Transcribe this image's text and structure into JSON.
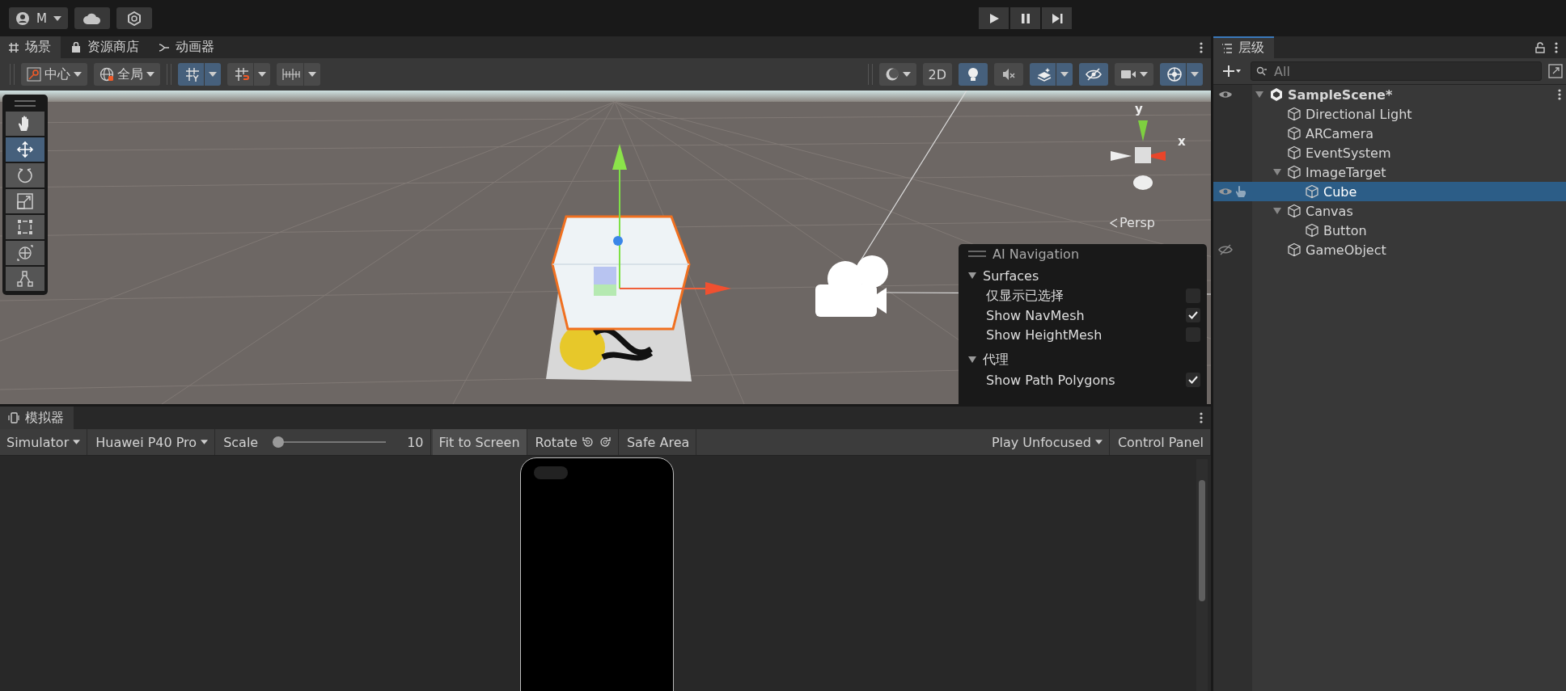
{
  "top_bar": {
    "account": {
      "label": "M"
    },
    "play_controls": [
      {
        "kind": "play",
        "selected": false
      },
      {
        "kind": "pause",
        "selected": false
      },
      {
        "kind": "step",
        "selected": false
      }
    ]
  },
  "scene_tabs": [
    {
      "label": "场景",
      "kind": "grid",
      "selected": true
    },
    {
      "label": "资源商店",
      "kind": "bag",
      "selected": false
    },
    {
      "label": "动画器",
      "kind": "branch",
      "selected": false
    }
  ],
  "scene_toolbar": {
    "left": [
      {
        "kind": "pivot",
        "label": "中心",
        "selected": false,
        "dropdown": true
      },
      {
        "kind": "global",
        "label": "全局",
        "selected": false,
        "dropdown": true
      },
      {
        "kind": "grid-snap",
        "selected": true,
        "dropdown": true
      },
      {
        "kind": "snap",
        "selected": false,
        "dropdown": true
      },
      {
        "kind": "increment",
        "selected": false,
        "dropdown": true
      }
    ],
    "right": [
      {
        "kind": "shading",
        "selected": false,
        "dropdown": true
      },
      {
        "kind": "text",
        "label": "2D",
        "selected": false,
        "dropdown": false
      },
      {
        "kind": "light",
        "selected": true,
        "dropdown": false
      },
      {
        "kind": "audio",
        "selected": false,
        "dropdown": false
      },
      {
        "kind": "effects",
        "selected": true,
        "dropdown": true
      },
      {
        "kind": "visibility",
        "selected": true,
        "dropdown": false
      },
      {
        "kind": "camera",
        "selected": false,
        "dropdown": true
      },
      {
        "kind": "gizmos",
        "selected": true,
        "dropdown": true
      }
    ]
  },
  "tools": [
    {
      "kind": "hand",
      "selected": false
    },
    {
      "kind": "move",
      "selected": true
    },
    {
      "kind": "rotate",
      "selected": false
    },
    {
      "kind": "scale",
      "selected": false
    },
    {
      "kind": "rect",
      "selected": false
    },
    {
      "kind": "transform",
      "selected": false
    },
    {
      "kind": "custom",
      "selected": false
    }
  ],
  "scene_gizmo": {
    "y_label": "y",
    "x_label": "x",
    "projection": "Persp"
  },
  "ai_navigation": {
    "title": "AI Navigation",
    "sections": [
      {
        "title": "Surfaces",
        "expanded": true,
        "items": [
          {
            "label": "仅显示已选择",
            "checked": false
          },
          {
            "label": "Show NavMesh",
            "checked": true
          },
          {
            "label": "Show HeightMesh",
            "checked": false
          }
        ]
      },
      {
        "title": "代理",
        "expanded": true,
        "items": [
          {
            "label": "Show Path Polygons",
            "checked": true
          }
        ]
      }
    ]
  },
  "simulator": {
    "tab": "模拟器",
    "device_menu": "Simulator",
    "device": "Huawei P40 Pro",
    "scale_label": "Scale",
    "scale": {
      "level": 0.0
    },
    "scale_value": "10",
    "fit_to_screen": {
      "label": "Fit to Screen",
      "selected": true
    },
    "rotate_label": "Rotate",
    "safe_area": {
      "label": "Safe Area",
      "selected": false
    },
    "play_mode": "Play Unfocused",
    "control_panel": "Control Panel"
  },
  "hierarchy": {
    "tab": "层级",
    "search": {
      "placeholder": "All"
    },
    "tree": [
      {
        "label": "SampleScene*",
        "kind": "scene",
        "expanded": true,
        "selected": false,
        "hidden": false,
        "children": [
          {
            "label": "Directional Light",
            "kind": "object",
            "selected": false,
            "hidden": false
          },
          {
            "label": "ARCamera",
            "kind": "object",
            "selected": false,
            "hidden": false
          },
          {
            "label": "EventSystem",
            "kind": "object",
            "selected": false,
            "hidden": false
          },
          {
            "label": "ImageTarget",
            "kind": "object",
            "expanded": true,
            "selected": false,
            "hidden": false,
            "children": [
              {
                "label": "Cube",
                "kind": "object",
                "selected": true,
                "hidden": false
              }
            ]
          },
          {
            "label": "Canvas",
            "kind": "object",
            "expanded": true,
            "selected": false,
            "hidden": false,
            "children": [
              {
                "label": "Button",
                "kind": "object",
                "selected": false,
                "hidden": false
              }
            ]
          },
          {
            "label": "GameObject",
            "kind": "object",
            "selected": false,
            "hidden": true
          }
        ]
      }
    ]
  }
}
